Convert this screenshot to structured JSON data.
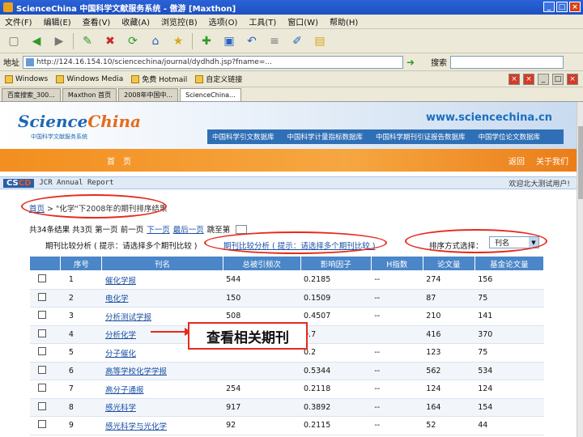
{
  "window": {
    "title": "ScienceChina 中国科学文献服务系统 - 傲游 [Maxthon]",
    "min": "_",
    "max": "□",
    "close": "×"
  },
  "menu": [
    "文件(F)",
    "编辑(E)",
    "查看(V)",
    "收藏(A)",
    "浏览控(B)",
    "选项(O)",
    "工具(T)",
    "窗口(W)",
    "帮助(H)"
  ],
  "address": {
    "label": "地址",
    "url": "http://124.16.154.10/sciencechina/journal/dydhdh.jsp?fname=...",
    "search_label": "搜索"
  },
  "favorites": [
    "Windows",
    "Windows Media",
    "免费 Hotmail",
    "自定义链接"
  ],
  "tabs": [
    "百度搜索_300...",
    "Maxthon 首页",
    "2008年中国中...",
    "ScienceChina..."
  ],
  "banner": {
    "logo_science": "Science",
    "logo_china": "China",
    "logo_sub": "中国科学文献服务系统",
    "url": "www.sciencechina.cn",
    "nav": [
      "中国科学引文数据库",
      "中国科学计量指标数据库",
      "中国科学期刊引证报告数据库",
      "中国学位论文数据库"
    ]
  },
  "orange": {
    "home": "首　页",
    "back": "返回",
    "about": "关于我们"
  },
  "cscd": {
    "logo_a": "CS",
    "logo_b": "CD",
    "title": "JCR Annual Report",
    "welcome": "欢迎北大测试用户!"
  },
  "breadcrumb": {
    "home": "首页",
    "rest": " > \"化学\"下2008年的期刊排序结果"
  },
  "pager": {
    "summary": "共34条结果 共3页 第一页 前一页",
    "next": "下一页",
    "last": "最后一页",
    "jump": "跳至第"
  },
  "compare": {
    "label": "期刊比较分析 ( 提示：请选择多个期刊比较 )",
    "category_link": "期刊比较分析 ( 提示：请选择多个期刊比较 )",
    "sort_label": "排序方式选择：",
    "sort_value": "刊名"
  },
  "table": {
    "headers": [
      "",
      "序号",
      "刊名",
      "总被引频次",
      "影响因子",
      "H指数",
      "论文量",
      "基金论文量"
    ],
    "rows": [
      [
        "1",
        "催化学报",
        "544",
        "0.2185",
        "--",
        "274",
        "156"
      ],
      [
        "2",
        "电化学",
        "150",
        "0.1509",
        "--",
        "87",
        "75"
      ],
      [
        "3",
        "分析测试学报",
        "508",
        "0.4507",
        "--",
        "210",
        "141"
      ],
      [
        "4",
        "分析化学",
        "",
        "0.7",
        "",
        "416",
        "370"
      ],
      [
        "5",
        "分子催化",
        "",
        "0.2",
        "--",
        "123",
        "75"
      ],
      [
        "6",
        "高等学校化学学报",
        "",
        "0.5344",
        "--",
        "562",
        "534"
      ],
      [
        "7",
        "高分子通报",
        "254",
        "0.2118",
        "--",
        "124",
        "124"
      ],
      [
        "8",
        "感光科学",
        "917",
        "0.3892",
        "--",
        "164",
        "154"
      ],
      [
        "9",
        "感光科学与光化学",
        "92",
        "0.2115",
        "--",
        "52",
        "44"
      ]
    ]
  },
  "callout": "查看相关期刊"
}
